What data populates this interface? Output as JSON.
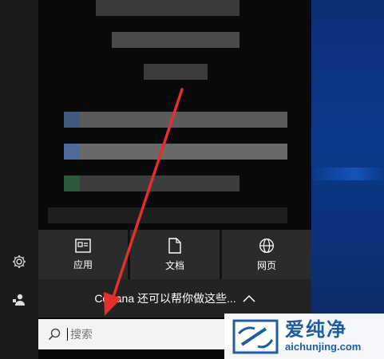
{
  "tiles": [
    {
      "label": "应用",
      "icon": "apps-icon"
    },
    {
      "label": "文档",
      "icon": "document-icon"
    },
    {
      "label": "网页",
      "icon": "globe-icon"
    }
  ],
  "cortana": {
    "text": "Cortana 还可以帮你做这些...",
    "icon": "chevron-up-icon"
  },
  "search": {
    "placeholder": "搜索",
    "icon": "search-icon"
  },
  "rail": {
    "icons": [
      "settings-icon",
      "user-icon"
    ]
  },
  "watermark": {
    "brand": "爱纯净",
    "url": "aichunjing.com"
  },
  "colors": {
    "arrow": "#e0312b",
    "accent": "#1f5d9e",
    "tile_bg": "#2b2b2b"
  }
}
